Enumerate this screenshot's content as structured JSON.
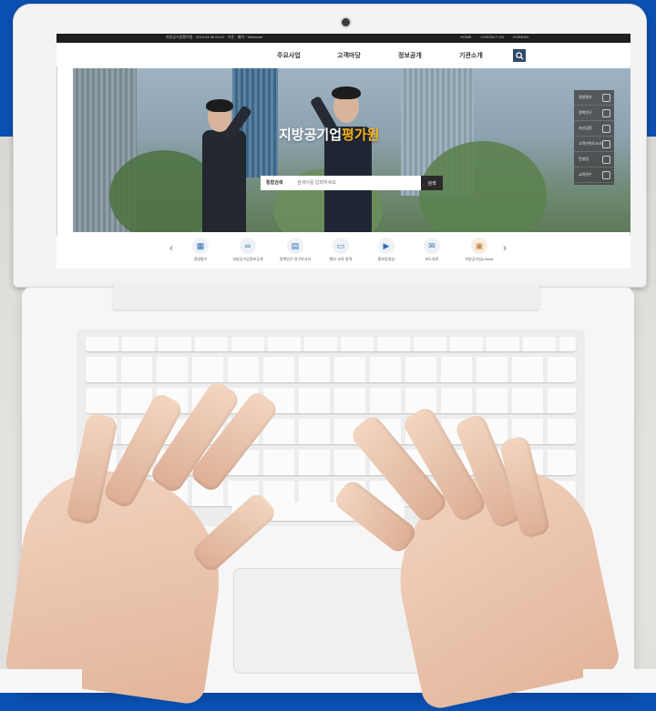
{
  "site": {
    "top_strip_info": "지방공기업평가원 · 2019.04.26 09:41 · 기준 · 별의 · Welcome",
    "top_links": [
      "HOME",
      "CONTACT US",
      "KOREAN"
    ]
  },
  "nav": {
    "menu": [
      "주요사업",
      "고객마당",
      "정보공개",
      "기관소개"
    ]
  },
  "hero": {
    "title_main": "지방공기업",
    "title_accent": "평가원",
    "search_label": "통합검색",
    "search_placeholder": "검색어를 입력하세요",
    "search_button": "검색"
  },
  "quick_menu": [
    "경영평가",
    "정책연구",
    "자산감정",
    "고객만족도조사",
    "컨설팅",
    "교육연수"
  ],
  "icons": [
    {
      "label": "경영평가",
      "icon": "chart-icon"
    },
    {
      "label": "지방공기업정보공개",
      "icon": "link-icon"
    },
    {
      "label": "정책연구·연구보고서",
      "icon": "chart-icon"
    },
    {
      "label": "행사·교육·용역",
      "icon": "book-icon"
    },
    {
      "label": "홍보동영상",
      "icon": "video-icon"
    },
    {
      "label": "보도자료",
      "icon": "mail-icon"
    },
    {
      "label": "지방공기업e-Book",
      "icon": "ebook-icon"
    }
  ],
  "colors": {
    "brand_accent": "#f6b21b",
    "nav_dark": "#1e1e1e",
    "search_button": "#2f4a6b",
    "background_blue": "#0b4fb0"
  }
}
